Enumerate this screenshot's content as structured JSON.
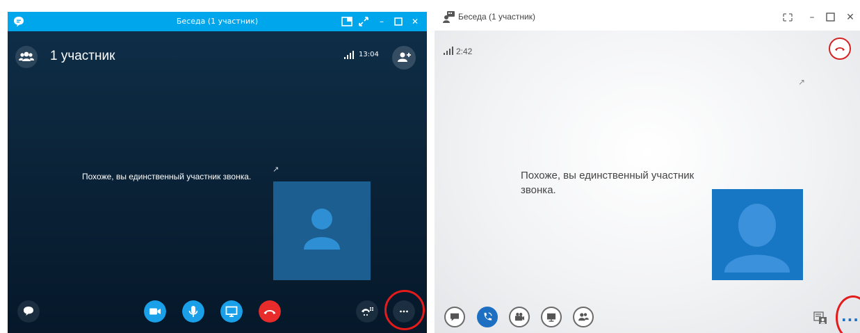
{
  "left": {
    "title": "Беседа (1 участник)",
    "participants_label": "1 участник",
    "time": "13:04",
    "message": "Похоже, вы единственный участник звонка.",
    "more_label": "···",
    "colors": {
      "titlebar": "#00a6ec",
      "background": "#0b2439",
      "video_tile": "#1c5e8f",
      "video_btn": "#1aa0e8",
      "hangup": "#e82b2b",
      "highlight_ring": "#e31b1b"
    },
    "icons": [
      "chat-bubble-icon",
      "participants-icon",
      "signal-icon",
      "add-person-icon",
      "video-icon",
      "microphone-icon",
      "screen-share-icon",
      "hangup-icon",
      "dialpad-icon",
      "more-icon",
      "expand-icon",
      "avatar-icon"
    ]
  },
  "right": {
    "title": "Беседа (1 участник)",
    "time": "2:42",
    "message": "Похоже, вы единственный участник звонка.",
    "more_label": "···",
    "colors": {
      "video_tile": "#1877c5",
      "accent": "#1c6fc1",
      "hangup": "#d32424",
      "highlight_ring": "#e31b1b"
    },
    "icons": [
      "conversation-icon",
      "signal-icon",
      "hangup-icon",
      "expand-icon",
      "im-icon",
      "call-icon",
      "video-icon",
      "present-icon",
      "people-icon",
      "layout-icon",
      "more-icon",
      "avatar-icon"
    ]
  }
}
